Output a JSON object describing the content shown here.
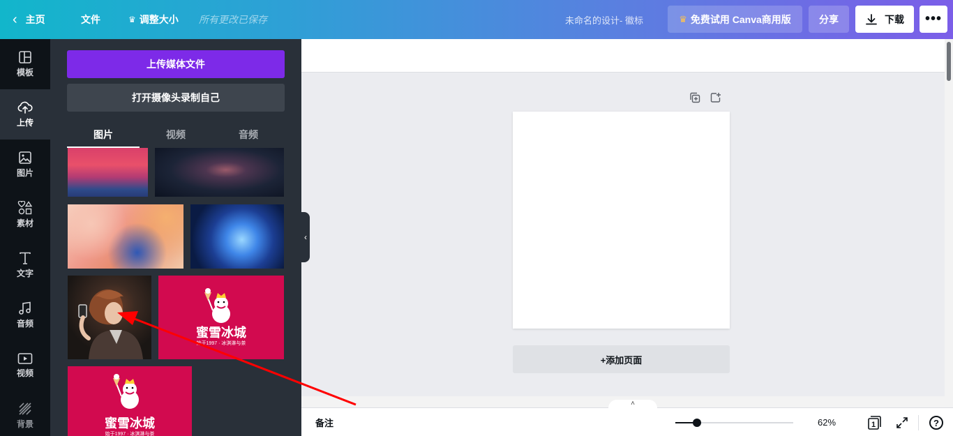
{
  "topbar": {
    "back_label": "主页",
    "file_label": "文件",
    "resize_label": "调整大小",
    "saved_label": "所有更改已保存",
    "design_title": "未命名的设计- 徽标",
    "trial_label": "免费试用 Canva商用版",
    "share_label": "分享",
    "download_label": "下载",
    "more_label": "•••"
  },
  "rail": {
    "items": [
      {
        "label": "模板",
        "icon": "layout-icon"
      },
      {
        "label": "上传",
        "icon": "cloud-upload-icon"
      },
      {
        "label": "图片",
        "icon": "image-icon"
      },
      {
        "label": "素材",
        "icon": "shapes-icon"
      },
      {
        "label": "文字",
        "icon": "text-icon"
      },
      {
        "label": "音频",
        "icon": "music-note-icon"
      },
      {
        "label": "视频",
        "icon": "video-icon"
      },
      {
        "label": "背景",
        "icon": "pattern-icon"
      }
    ]
  },
  "panel": {
    "upload_label": "上传媒体文件",
    "camera_label": "打开摄像头录制自己",
    "tabs": [
      "图片",
      "视频",
      "音频"
    ],
    "brand": {
      "name": "蜜雪冰城",
      "tagline": "始于1997 · 冰淇淋与茶"
    }
  },
  "canvas": {
    "add_page_label": "+添加页面"
  },
  "bottombar": {
    "notes_label": "备注",
    "zoom_value": "62%",
    "zoom_fraction": 0.12,
    "page_count": "1",
    "help_label": "?"
  },
  "colors": {
    "accent_purple": "#7d2ae8",
    "brand_red": "#d20a4f",
    "annotation_arrow": "#ff0000"
  }
}
